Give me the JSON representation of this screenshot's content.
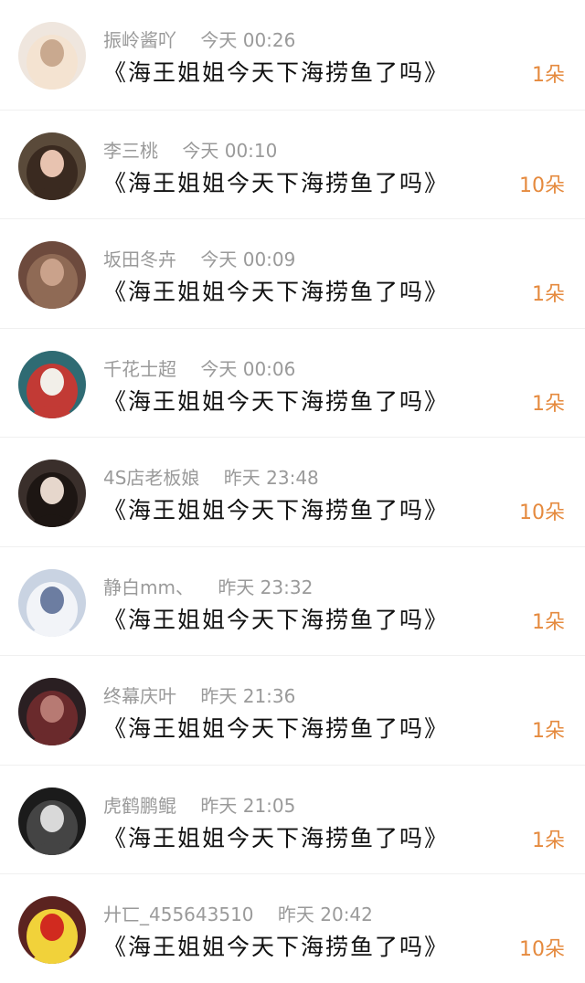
{
  "rows": [
    {
      "name": "振岭酱吖",
      "time": "今天 00:26",
      "title": "《海王姐姐今天下海捞鱼了吗》",
      "count": "1朵",
      "avatar": {
        "bg": "#efe6de",
        "fg": "#c9a98f",
        "accent": "#f4e3d1"
      }
    },
    {
      "name": "李三桃",
      "time": "今天 00:10",
      "title": "《海王姐姐今天下海捞鱼了吗》",
      "count": "10朵",
      "avatar": {
        "bg": "#5a4a3a",
        "fg": "#e8c3b0",
        "accent": "#3a2a20"
      }
    },
    {
      "name": "坂田冬卉",
      "time": "今天 00:09",
      "title": "《海王姐姐今天下海捞鱼了吗》",
      "count": "1朵",
      "avatar": {
        "bg": "#6d4a3d",
        "fg": "#caa28b",
        "accent": "#8f6a55"
      }
    },
    {
      "name": "千花士超",
      "time": "今天 00:06",
      "title": "《海王姐姐今天下海捞鱼了吗》",
      "count": "1朵",
      "avatar": {
        "bg": "#2f6b73",
        "fg": "#f2efe9",
        "accent": "#c23a35"
      }
    },
    {
      "name": "4S店老板娘",
      "time": "昨天 23:48",
      "title": "《海王姐姐今天下海捞鱼了吗》",
      "count": "10朵",
      "avatar": {
        "bg": "#3a2f2b",
        "fg": "#e6d7cc",
        "accent": "#1d1613"
      }
    },
    {
      "name": "静白mm、",
      "time": "昨天 23:32",
      "title": "《海王姐姐今天下海捞鱼了吗》",
      "count": "1朵",
      "avatar": {
        "bg": "#c9d3e2",
        "fg": "#6c7da1",
        "accent": "#f2f4f8"
      }
    },
    {
      "name": "终幕庆叶",
      "time": "昨天 21:36",
      "title": "《海王姐姐今天下海捞鱼了吗》",
      "count": "1朵",
      "avatar": {
        "bg": "#2a1f22",
        "fg": "#b77a73",
        "accent": "#6a2a2c"
      }
    },
    {
      "name": "虎鹤鹏鲲",
      "time": "昨天 21:05",
      "title": "《海王姐姐今天下海捞鱼了吗》",
      "count": "1朵",
      "avatar": {
        "bg": "#1b1b1b",
        "fg": "#d9d9d9",
        "accent": "#444444"
      }
    },
    {
      "name": "廾匸_455643510",
      "time": "昨天 20:42",
      "title": "《海王姐姐今天下海捞鱼了吗》",
      "count": "10朵",
      "avatar": {
        "bg": "#5b2320",
        "fg": "#d12a1f",
        "accent": "#f1d23a"
      }
    }
  ]
}
